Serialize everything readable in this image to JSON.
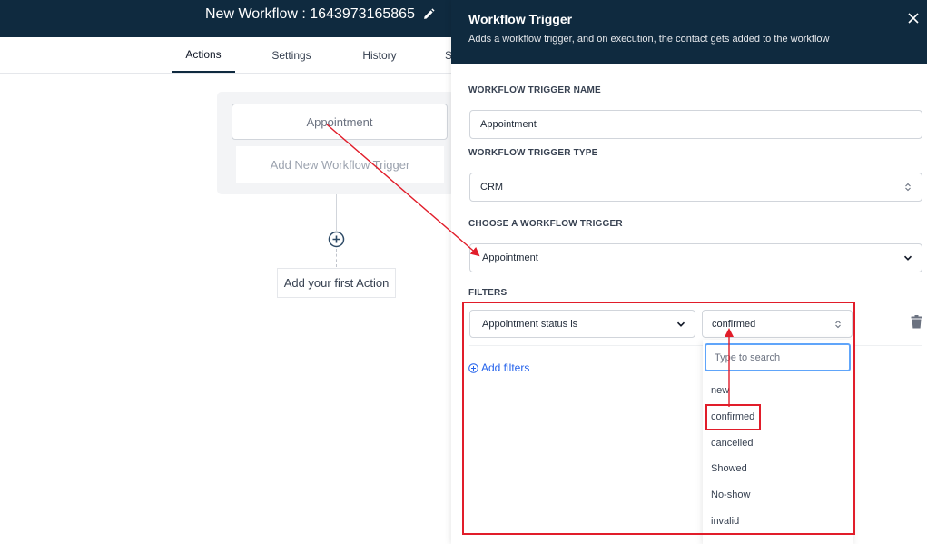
{
  "workflow": {
    "title": "New Workflow : 1643973165865",
    "tabs": [
      "Actions",
      "Settings",
      "History",
      "S"
    ],
    "trigger_card": "Appointment",
    "add_trigger": "Add New Workflow Trigger",
    "first_action": "Add your first Action"
  },
  "panel": {
    "title": "Workflow Trigger",
    "subtitle": "Adds a workflow trigger, and on execution, the contact gets added to the workflow",
    "name_label": "WORKFLOW TRIGGER NAME",
    "name_value": "Appointment",
    "type_label": "WORKFLOW TRIGGER TYPE",
    "type_value": "CRM",
    "choose_label": "CHOOSE A WORKFLOW TRIGGER",
    "choose_value": "Appointment",
    "filters_label": "FILTERS",
    "filter_field": "Appointment status is",
    "filter_value": "confirmed",
    "add_filters": "Add filters",
    "search_placeholder": "Type to search",
    "options": [
      "new",
      "confirmed",
      "cancelled",
      "Showed",
      "No-show",
      "invalid"
    ]
  },
  "colors": {
    "header_bg": "#0f2a3f",
    "annotation": "#e11d2a",
    "link": "#2563eb"
  },
  "icons": [
    "edit-icon",
    "plus-circle-icon",
    "close-icon",
    "updown-chevron-icon",
    "chevron-down-icon",
    "trash-icon",
    "plus-circle-outline-icon"
  ]
}
